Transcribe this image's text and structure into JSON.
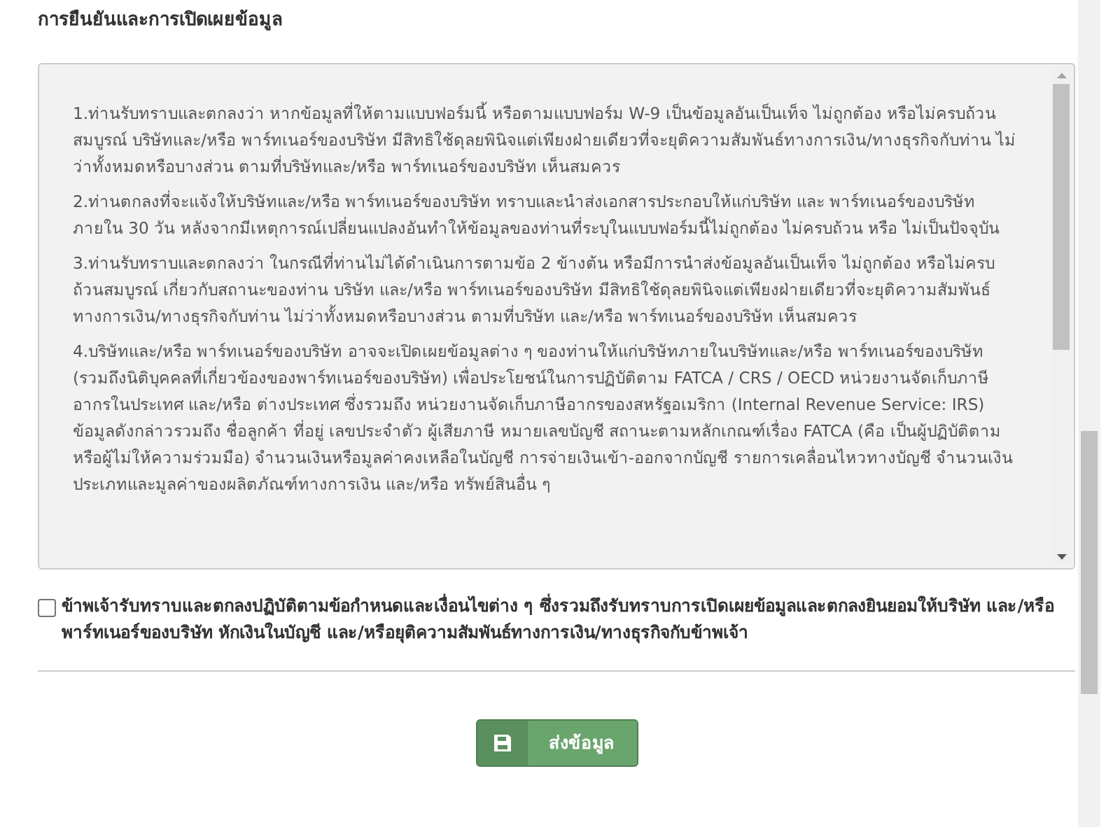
{
  "title": "การยืนยันและการเปิดเผยข้อมูล",
  "terms": [
    "1.ท่านรับทราบและตกลงว่า หากข้อมูลที่ให้ตามแบบฟอร์มนี้ หรือตามแบบฟอร์ม W-9 เป็นข้อมูลอันเป็นเท็จ ไม่ถูกต้อง หรือไม่ครบถ้วนสมบูรณ์ บริษัทและ/หรือ พาร์ทเนอร์ของบริษัท มีสิทธิใช้ดุลยพินิจแต่เพียงฝ่ายเดียวที่จะยุติความสัมพันธ์ทางการเงิน/ทางธุรกิจกับท่าน ไม่ว่าทั้งหมดหรือบางส่วน ตามที่บริษัทและ/หรือ พาร์ทเนอร์ของบริษัท เห็นสมควร",
    "2.ท่านตกลงที่จะแจ้งให้บริษัทและ/หรือ พาร์ทเนอร์ของบริษัท ทราบและนำส่งเอกสารประกอบให้แก่บริษัท และ พาร์ทเนอร์ของบริษัท ภายใน 30 วัน หลังจากมีเหตุการณ์เปลี่ยนแปลงอันทำให้ข้อมูลของท่านที่ระบุในแบบฟอร์มนี้ไม่ถูกต้อง ไม่ครบถ้วน หรือ ไม่เป็นปัจจุบัน",
    "3.ท่านรับทราบและตกลงว่า ในกรณีที่ท่านไม่ได้ดำเนินการตามข้อ 2 ข้างต้น หรือมีการนำส่งข้อมูลอันเป็นเท็จ ไม่ถูกต้อง หรือไม่ครบถ้วนสมบูรณ์ เกี่ยวกับสถานะของท่าน บริษัท และ/หรือ พาร์ทเนอร์ของบริษัท มีสิทธิใช้ดุลยพินิจแต่เพียงฝ่ายเดียวที่จะยุติความสัมพันธ์ทางการเงิน/ทางธุรกิจกับท่าน ไม่ว่าทั้งหมดหรือบางส่วน ตามที่บริษัท และ/หรือ พาร์ทเนอร์ของบริษัท เห็นสมควร",
    "4.บริษัทและ/หรือ พาร์ทเนอร์ของบริษัท อาจจะเปิดเผยข้อมูลต่าง ๆ ของท่านให้แก่บริษัทภายในบริษัทและ/หรือ พาร์ทเนอร์ของบริษัท (รวมถึงนิติบุคคลที่เกี่ยวข้องของพาร์ทเนอร์ของบริษัท) เพื่อประโยชน์ในการปฏิบัติตาม FATCA / CRS / OECD หน่วยงานจัดเก็บภาษีอากรในประเทศ และ/หรือ ต่างประเทศ ซึ่งรวมถึง หน่วยงานจัดเก็บภาษีอากรของสหรัฐอเมริกา (Internal Revenue Service: IRS) ข้อมูลดังกล่าวรวมถึง ชื่อลูกค้า ที่อยู่ เลขประจำตัว ผู้เสียภาษี หมายเลขบัญชี สถานะตามหลักเกณฑ์เรื่อง FATCA (คือ เป็นผู้ปฏิบัติตาม หรือผู้ไม่ให้ความร่วมมือ) จำนวนเงินหรือมูลค่าคงเหลือในบัญชี การจ่ายเงินเข้า-ออกจากบัญชี รายการเคลื่อนไหวทางบัญชี จำนวนเงิน ประเภทและมูลค่าของผลิตภัณฑ์ทางการเงิน และ/หรือ ทรัพย์สินอื่น ๆ"
  ],
  "agreement": {
    "label": "ข้าพเจ้ารับทราบและตกลงปฏิบัติตามข้อกำหนดและเงื่อนไขต่าง ๆ ซึ่งรวมถึงรับทราบการเปิดเผยข้อมูลและตกลงยินยอมให้บริษัท และ/หรือ พาร์ทเนอร์ของบริษัท หักเงินในบัญชี และ/หรือยุติความสัมพันธ์ทางการเงิน/ทางธุรกิจกับข้าพเจ้า",
    "checked": false
  },
  "submit_button": {
    "label": "ส่งข้อมูล"
  }
}
